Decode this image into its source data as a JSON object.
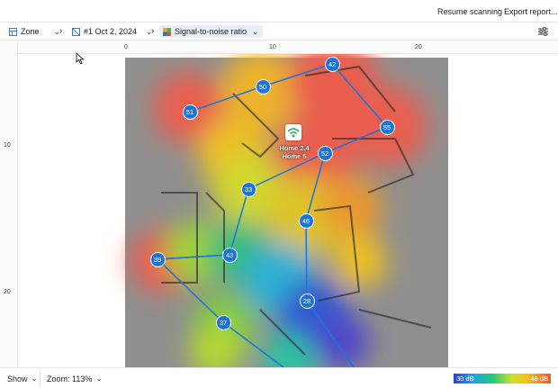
{
  "header": {
    "resume_label": "Resume scanning",
    "export_label": "Export report..."
  },
  "toolbar": {
    "zone_label": "Zone",
    "survey_label": "#1 Oct 2, 2024",
    "view_label": "Signal-to-noise ratio"
  },
  "rulers": {
    "top_ticks": [
      "0",
      "10",
      "20"
    ],
    "left_ticks": [
      "10",
      "20"
    ]
  },
  "access_point": {
    "label_line1": "Home 2.4",
    "label_line2": "Home 5"
  },
  "scan_points": [
    "42",
    "50",
    "51",
    "55",
    "52",
    "33",
    "46",
    "43",
    "39",
    "28",
    "37"
  ],
  "footer": {
    "show_label": "Show",
    "zoom_label": "Zoom: 113%",
    "legend_min": "30 dB",
    "legend_max": "48 dB"
  },
  "colors": {
    "point_fill": "#1b74d9",
    "path_stroke": "#1b74d9",
    "selected_bg": "#e8eef8"
  }
}
